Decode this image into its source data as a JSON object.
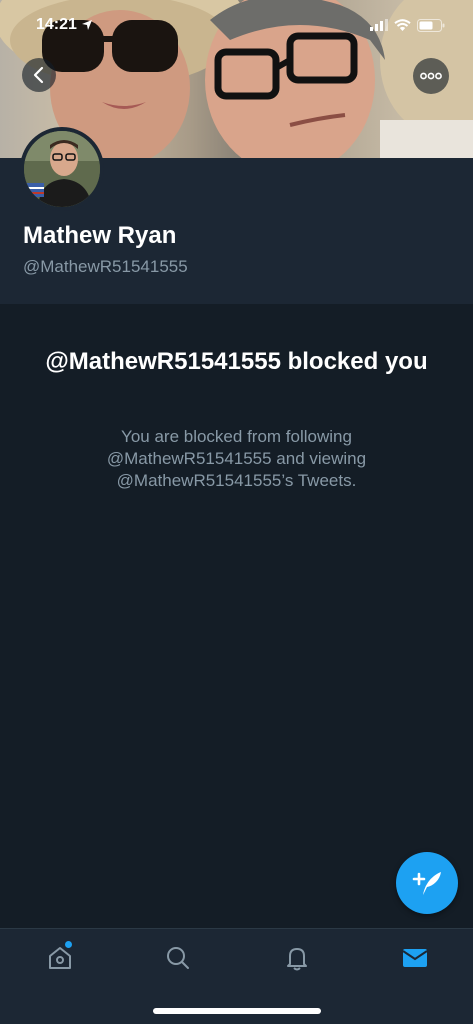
{
  "status_bar": {
    "time": "14:21",
    "location_icon": "location-arrow-icon",
    "signal_icon": "cellular-signal-icon",
    "wifi_icon": "wifi-icon",
    "battery_icon": "battery-icon"
  },
  "header": {
    "back_icon": "chevron-left-icon",
    "more_icon": "more-horizontal-icon"
  },
  "profile": {
    "display_name": "Mathew Ryan",
    "handle": "@MathewR51541555"
  },
  "blocked": {
    "title": "@MathewR51541555 blocked you",
    "description": "You are blocked from following @MathewR51541555 and viewing @MathewR51541555’s Tweets."
  },
  "compose": {
    "icon": "compose-tweet-icon"
  },
  "tabs": [
    {
      "name": "home",
      "icon": "home-icon",
      "has_badge": true
    },
    {
      "name": "search",
      "icon": "search-icon"
    },
    {
      "name": "notifications",
      "icon": "bell-icon"
    },
    {
      "name": "messages",
      "icon": "envelope-icon",
      "active": true
    }
  ],
  "colors": {
    "background": "#141d26",
    "header_background": "#1c2734",
    "accent": "#1da1f2",
    "secondary_text": "#8899a6"
  }
}
